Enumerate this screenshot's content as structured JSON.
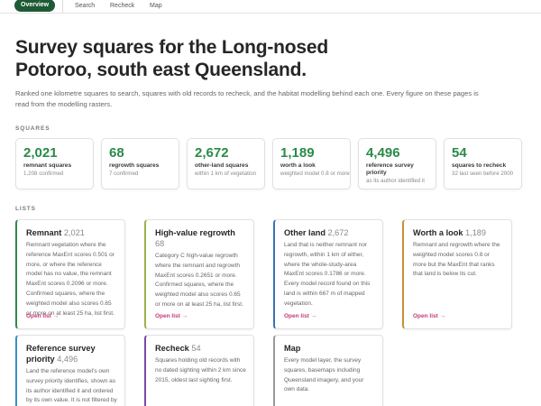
{
  "nav": {
    "overview": "Overview",
    "search": "Search",
    "recheck": "Recheck",
    "map": "Map"
  },
  "title": "Survey squares for the Long-nosed Potoroo, south east Queensland.",
  "intro": "Ranked one kilometre squares to search, squares with old records to recheck, and the habitat modelling behind each one. Every figure on these pages is read from the modelling rasters.",
  "squares_label": "SQUARES",
  "stats": [
    {
      "value": "2,021",
      "label": "remnant squares",
      "sub": "1,208 confirmed"
    },
    {
      "value": "68",
      "label": "regrowth squares",
      "sub": "7 confirmed"
    },
    {
      "value": "2,672",
      "label": "other-land squares",
      "sub": "within 1 km of vegetation"
    },
    {
      "value": "1,189",
      "label": "worth a look",
      "sub": "weighted model 0.8 or more"
    },
    {
      "value": "4,496",
      "label": "reference survey priority",
      "sub": "as its author identified it"
    },
    {
      "value": "54",
      "label": "squares to recheck",
      "sub": "32 last seen before 2000"
    }
  ],
  "lists_label": "LISTS",
  "lists": [
    {
      "title": "Remnant",
      "count": "2,021",
      "desc": "Remnant vegetation where the reference MaxEnt scores 0.501 or more, or where the reference model has no value, the remnant MaxEnt scores 0.2096 or more. Confirmed squares, where the weighted model also scores 0.65 or more on at least 25 ha, list first.",
      "link": "Open list →"
    },
    {
      "title": "High-value regrowth",
      "count": "68",
      "desc": "Category C high-value regrowth where the remnant and regrowth MaxEnt scores 0.2651 or more. Confirmed squares, where the weighted model also scores 0.65 or more on at least 25 ha, list first.",
      "link": "Open list →"
    },
    {
      "title": "Other land",
      "count": "2,672",
      "desc": "Land that is neither remnant nor regrowth, within 1 km of either, where the whole-study-area MaxEnt scores 0.1786 or more. Every model record found on this land is within 667 m of mapped vegetation.",
      "link": "Open list →"
    },
    {
      "title": "Worth a look",
      "count": "1,189",
      "desc": "Remnant and regrowth where the weighted model scores 0.8 or more but the MaxEnt that ranks that land is below its cut.",
      "link": "Open list →"
    },
    {
      "title": "Reference survey priority",
      "count": "4,496",
      "desc": "Land the reference model's own survey priority identifies, shown as its author identified it and ordered by its own value. It is not filtered by the rules used for the other lists.",
      "link": ""
    },
    {
      "title": "Recheck",
      "count": "54",
      "desc": "Squares holding old records with no dated sighting within 2 km since 2015, oldest last sighting first.",
      "link": ""
    },
    {
      "title": "Map",
      "count": "",
      "desc": "Every model layer, the survey squares, basemaps including Queensland imagery, and your own data.",
      "link": ""
    }
  ]
}
